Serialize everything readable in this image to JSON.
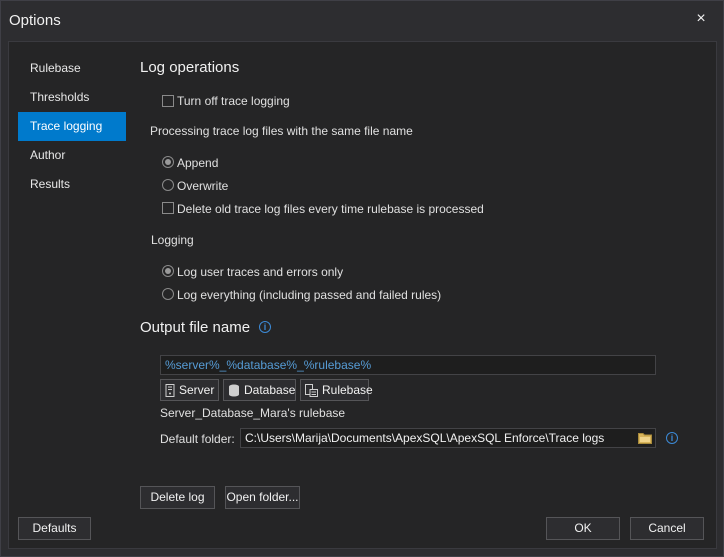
{
  "window": {
    "title": "Options",
    "close_glyph": "×"
  },
  "nav": {
    "items": [
      {
        "label": "Rulebase"
      },
      {
        "label": "Thresholds"
      },
      {
        "label": "Trace logging"
      },
      {
        "label": "Author"
      },
      {
        "label": "Results"
      }
    ],
    "selected": "Trace logging"
  },
  "log_operations": {
    "heading": "Log operations",
    "turn_off_trace": {
      "label": "Turn off trace logging",
      "checked": false
    },
    "same_name_label": "Processing trace log files with the same file name",
    "append": {
      "label": "Append",
      "selected": true
    },
    "overwrite": {
      "label": "Overwrite",
      "selected": false
    },
    "delete_old": {
      "label": "Delete old trace log files every time rulebase is processed",
      "checked": false
    },
    "logging_label": "Logging",
    "log_user": {
      "label": "Log user traces and errors only",
      "selected": true
    },
    "log_everything": {
      "label": "Log everything (including passed and failed rules)",
      "selected": false
    }
  },
  "output": {
    "heading": "Output file name",
    "pattern": "%server%_%database%_%rulebase%",
    "server_button": "Server",
    "database_button": "Database",
    "rulebase_button": "Rulebase",
    "preview": "Server_Database_Mara's rulebase",
    "default_folder_label": "Default folder:",
    "default_folder_value": "C:\\Users\\Marija\\Documents\\ApexSQL\\ApexSQL Enforce\\Trace logs"
  },
  "actions": {
    "delete_log": "Delete log",
    "open_folder": "Open folder..."
  },
  "footer": {
    "defaults": "Defaults",
    "ok": "OK",
    "cancel": "Cancel"
  },
  "colors": {
    "accent": "#007acc",
    "background": "#2d2d30",
    "panel": "#252526",
    "token_text": "#569cd6",
    "info": "#3c8ad6"
  },
  "icons": [
    "close-icon",
    "info-icon",
    "server-icon",
    "database-icon",
    "rulebase-icon",
    "folder-icon"
  ]
}
